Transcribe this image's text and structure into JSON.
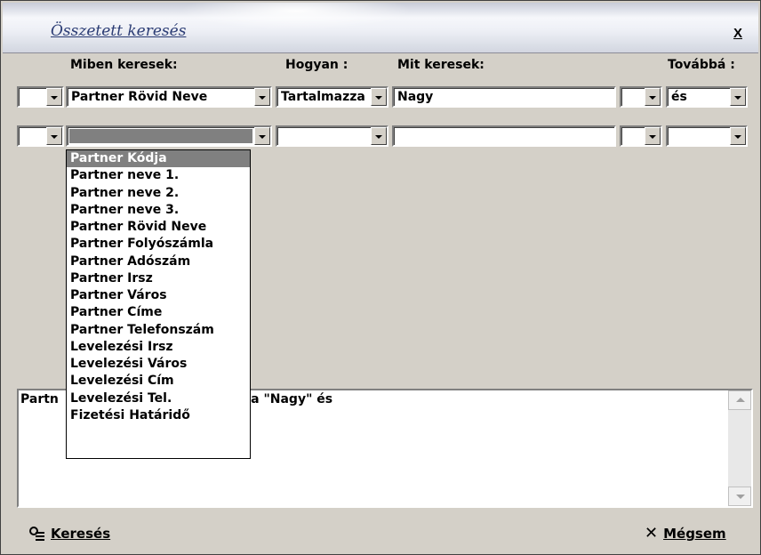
{
  "window": {
    "title": "Összetett keresés",
    "close_label": "X"
  },
  "headers": {
    "field": "Miben keresek:",
    "how": "Hogyan :",
    "what": "Mit keresek:",
    "next": "Továbbá :"
  },
  "rows": [
    {
      "prefix": "",
      "field": "Partner Rövid Neve",
      "how": "Tartalmazza",
      "what": "Nagy",
      "suffix": "",
      "next": "és"
    },
    {
      "prefix": "",
      "field": "",
      "how": "",
      "what": "",
      "suffix": "",
      "next": ""
    }
  ],
  "dropdown": {
    "options": [
      "Partner Kódja",
      "Partner neve 1.",
      "Partner neve 2.",
      "Partner neve 3.",
      "Partner Rövid Neve",
      "Partner Folyószámla",
      "Partner Adószám",
      "Partner Irsz",
      "Partner Város",
      "Partner Címe",
      "Partner Telefonszám",
      "Levelezési Irsz",
      "Levelezési Város",
      "Levelezési Cím",
      "Levelezési Tel.",
      "Fizetési Határidő"
    ],
    "active_index": 0
  },
  "memo": {
    "visible_left": "Partn",
    "visible_right": "za \"Nagy\" és"
  },
  "buttons": {
    "search_label": "Keresés",
    "cancel_label": "Mégsem"
  },
  "icons": {
    "search": "search-icon",
    "cancel": "close-icon"
  }
}
